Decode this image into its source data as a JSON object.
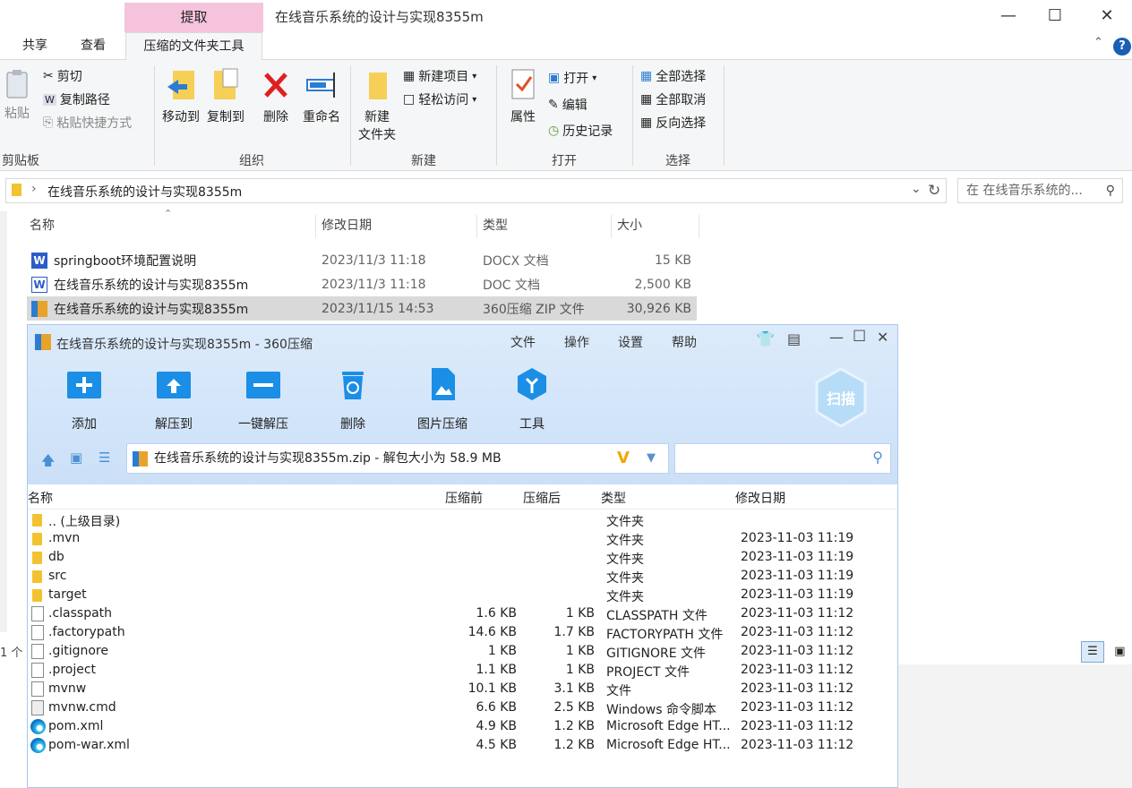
{
  "explorer": {
    "extract_tab": "提取",
    "window_title": "在线音乐系统的设计与实现8355m",
    "tabs": [
      "共享",
      "查看",
      "压缩的文件夹工具"
    ],
    "ribbon": {
      "clipboard": {
        "paste": "粘贴",
        "cut": "剪切",
        "copy_path": "复制路径",
        "paste_shortcut": "粘贴快捷方式",
        "label": "剪贴板"
      },
      "organize": {
        "move_to": "移动到",
        "copy_to": "复制到",
        "delete": "删除",
        "rename": "重命名",
        "label": "组织"
      },
      "new": {
        "new_folder_1": "新建",
        "new_folder_2": "文件夹",
        "new_item": "新建项目",
        "easy_access": "轻松访问",
        "label": "新建"
      },
      "open": {
        "properties": "属性",
        "open": "打开",
        "edit": "编辑",
        "history": "历史记录",
        "label": "打开"
      },
      "select": {
        "select_all": "全部选择",
        "select_none": "全部取消",
        "invert": "反向选择",
        "label": "选择"
      }
    },
    "address": "在线音乐系统的设计与实现8355m",
    "search_placeholder": "在 在线音乐系统的...",
    "columns": {
      "name": "名称",
      "modified": "修改日期",
      "type": "类型",
      "size": "大小"
    },
    "files": [
      {
        "name": "springboot环境配置说明",
        "modified": "2023/11/3 11:18",
        "type": "DOCX 文档",
        "size": "15 KB",
        "icon": "word-icon"
      },
      {
        "name": "在线音乐系统的设计与实现8355m",
        "modified": "2023/11/3 11:18",
        "type": "DOC 文档",
        "size": "2,500 KB",
        "icon": "word-doc-icon"
      },
      {
        "name": "在线音乐系统的设计与实现8355m",
        "modified": "2023/11/15 14:53",
        "type": "360压缩 ZIP 文件",
        "size": "30,926 KB",
        "icon": "zip-icon"
      }
    ],
    "status": "1 个"
  },
  "zip": {
    "title": "在线音乐系统的设计与实现8355m - 360压缩",
    "menu": [
      "文件",
      "操作",
      "设置",
      "帮助"
    ],
    "tools": [
      "添加",
      "解压到",
      "一键解压",
      "删除",
      "图片压缩",
      "工具"
    ],
    "scan": "扫描",
    "path": "在线音乐系统的设计与实现8355m.zip - 解包大小为 58.9 MB",
    "columns": {
      "name": "名称",
      "before": "压缩前",
      "after": "压缩后",
      "type": "类型",
      "modified": "修改日期"
    },
    "rows": [
      {
        "name": ".. (上级目录)",
        "before": "",
        "after": "",
        "type": "文件夹",
        "modified": "",
        "icon": "folder-icon"
      },
      {
        "name": ".mvn",
        "before": "",
        "after": "",
        "type": "文件夹",
        "modified": "2023-11-03 11:19",
        "icon": "folder-icon"
      },
      {
        "name": "db",
        "before": "",
        "after": "",
        "type": "文件夹",
        "modified": "2023-11-03 11:19",
        "icon": "folder-icon"
      },
      {
        "name": "src",
        "before": "",
        "after": "",
        "type": "文件夹",
        "modified": "2023-11-03 11:19",
        "icon": "folder-icon"
      },
      {
        "name": "target",
        "before": "",
        "after": "",
        "type": "文件夹",
        "modified": "2023-11-03 11:19",
        "icon": "folder-icon"
      },
      {
        "name": ".classpath",
        "before": "1.6 KB",
        "after": "1 KB",
        "type": "CLASSPATH 文件",
        "modified": "2023-11-03 11:12",
        "icon": "file-icon"
      },
      {
        "name": ".factorypath",
        "before": "14.6 KB",
        "after": "1.7 KB",
        "type": "FACTORYPATH 文件",
        "modified": "2023-11-03 11:12",
        "icon": "file-icon"
      },
      {
        "name": ".gitignore",
        "before": "1 KB",
        "after": "1 KB",
        "type": "GITIGNORE 文件",
        "modified": "2023-11-03 11:12",
        "icon": "file-icon"
      },
      {
        "name": ".project",
        "before": "1.1 KB",
        "after": "1 KB",
        "type": "PROJECT 文件",
        "modified": "2023-11-03 11:12",
        "icon": "file-icon"
      },
      {
        "name": "mvnw",
        "before": "10.1 KB",
        "after": "3.1 KB",
        "type": "文件",
        "modified": "2023-11-03 11:12",
        "icon": "file-icon"
      },
      {
        "name": "mvnw.cmd",
        "before": "6.6 KB",
        "after": "2.5 KB",
        "type": "Windows 命令脚本",
        "modified": "2023-11-03 11:12",
        "icon": "cmd-file-icon"
      },
      {
        "name": "pom.xml",
        "before": "4.9 KB",
        "after": "1.2 KB",
        "type": "Microsoft Edge HT...",
        "modified": "2023-11-03 11:12",
        "icon": "edge-icon"
      },
      {
        "name": "pom-war.xml",
        "before": "4.5 KB",
        "after": "1.2 KB",
        "type": "Microsoft Edge HT...",
        "modified": "2023-11-03 11:12",
        "icon": "edge-icon"
      }
    ]
  }
}
